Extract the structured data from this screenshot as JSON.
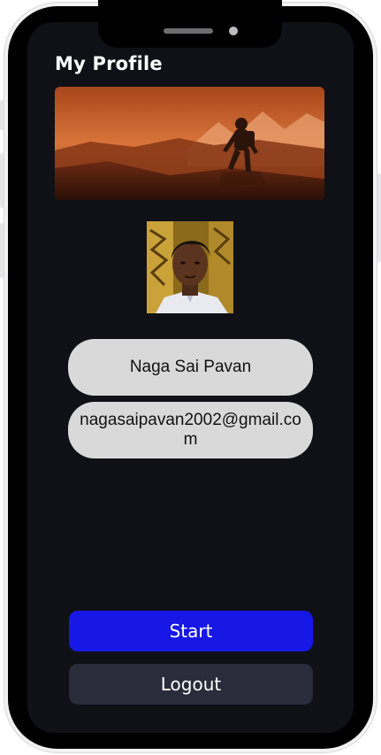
{
  "header": {
    "title": "My Profile"
  },
  "banner": {
    "image": "astronaut-desert-landscape"
  },
  "profile": {
    "avatar": "user-photo",
    "name": "Naga Sai Pavan",
    "email": "nagasaipavan2002@gmail.com"
  },
  "actions": {
    "start_label": "Start",
    "logout_label": "Logout"
  },
  "colors": {
    "screen_bg": "#0f1117",
    "start_button": "#1717e6",
    "logout_button": "#2b2c3b",
    "pill_bg": "#d9d9d9"
  }
}
